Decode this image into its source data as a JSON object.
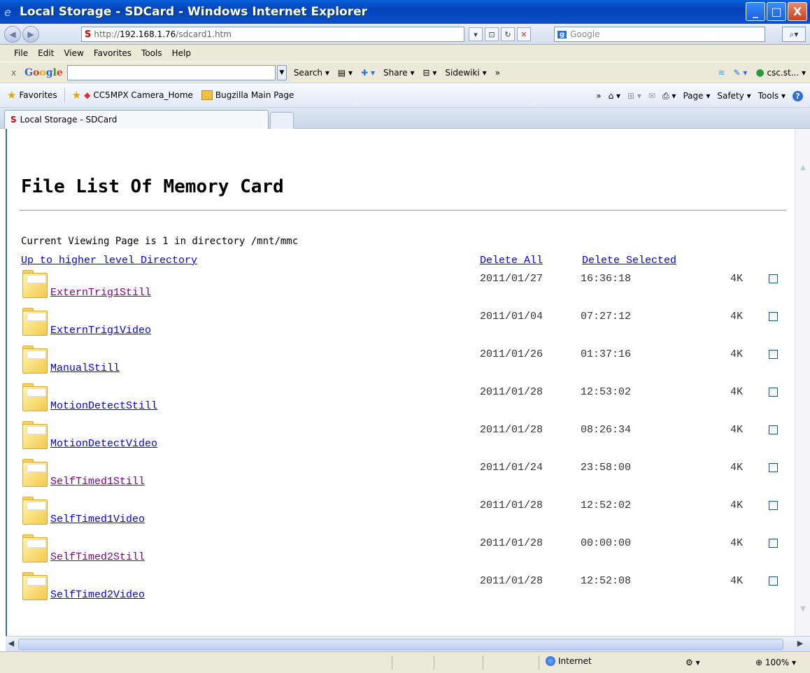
{
  "window": {
    "title": "Local Storage - SDCard - Windows Internet Explorer",
    "min": "_",
    "max": "□",
    "close": "X"
  },
  "address": {
    "url_prefix": "http://",
    "url_host": "192.168.1.76",
    "url_path": "/sdcard1.htm",
    "search_placeholder": "Google"
  },
  "menu": [
    "File",
    "Edit",
    "View",
    "Favorites",
    "Tools",
    "Help"
  ],
  "google_toolbar": {
    "close": "x",
    "search": "Search",
    "share": "Share",
    "sidewiki": "Sidewiki",
    "more": "»",
    "account": "csc.st..."
  },
  "favorites": {
    "label": "Favorites",
    "links": [
      "CC5MPX Camera_Home",
      "Bugzilla Main Page"
    ],
    "more": "»",
    "commands": [
      "Page",
      "Safety",
      "Tools"
    ]
  },
  "tab": {
    "label": "Local Storage - SDCard"
  },
  "page": {
    "title": "File List Of Memory Card",
    "subtitle_prefix": "Current Viewing Page is 1 in directory ",
    "subtitle_dir": "/mnt/mmc",
    "up_link": "Up to higher level Directory",
    "delete_all": "Delete All",
    "delete_selected": "Delete Selected"
  },
  "files": [
    {
      "name": "ExternTrig1Still",
      "date": "2011/01/27",
      "time": "16:36:18",
      "size": "4K",
      "visited": true
    },
    {
      "name": "ExternTrig1Video",
      "date": "2011/01/04",
      "time": "07:27:12",
      "size": "4K",
      "visited": false
    },
    {
      "name": "ManualStill",
      "date": "2011/01/26",
      "time": "01:37:16",
      "size": "4K",
      "visited": false
    },
    {
      "name": "MotionDetectStill",
      "date": "2011/01/28",
      "time": "12:53:02",
      "size": "4K",
      "visited": false
    },
    {
      "name": "MotionDetectVideo",
      "date": "2011/01/28",
      "time": "08:26:34",
      "size": "4K",
      "visited": false
    },
    {
      "name": "SelfTimed1Still",
      "date": "2011/01/24",
      "time": "23:58:00",
      "size": "4K",
      "visited": true
    },
    {
      "name": "SelfTimed1Video",
      "date": "2011/01/28",
      "time": "12:52:02",
      "size": "4K",
      "visited": false
    },
    {
      "name": "SelfTimed2Still",
      "date": "2011/01/28",
      "time": "00:00:00",
      "size": "4K",
      "visited": true
    },
    {
      "name": "SelfTimed2Video",
      "date": "2011/01/28",
      "time": "12:52:08",
      "size": "4K",
      "visited": false
    }
  ],
  "status": {
    "zone": "Internet",
    "zoom": "100%"
  }
}
